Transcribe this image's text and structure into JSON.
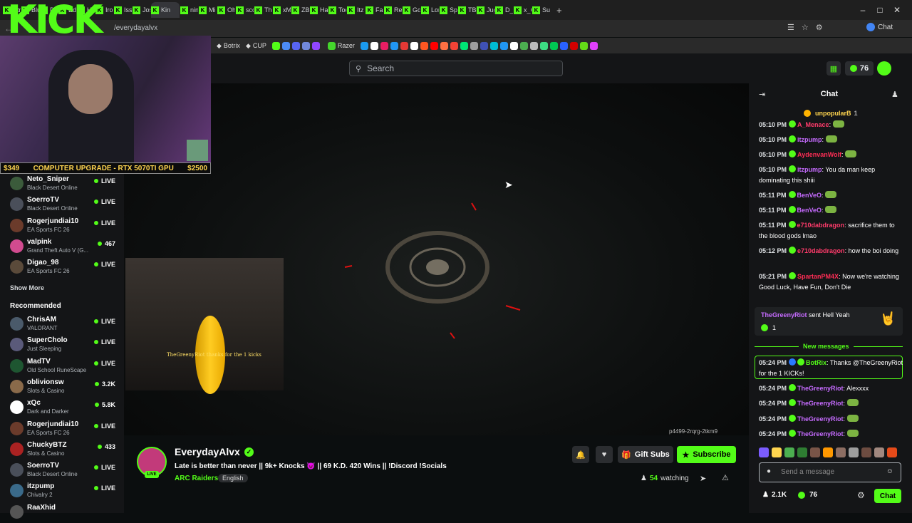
{
  "browser": {
    "tabs": [
      "Str",
      "Blu",
      "De",
      "Edi",
      "Ha",
      "Iro",
      "Iss",
      "Jos",
      "Kin",
      "nin",
      "Mi",
      "Oh",
      "sco",
      "The",
      "xM",
      "ZB",
      "Ha",
      "Toc",
      "Itz",
      "Fal",
      "Re",
      "Go",
      "Lor",
      "Spi",
      "TB",
      "Jug",
      "D_",
      "x_C",
      "Sul"
    ],
    "url": "/everydayalvx",
    "chat_button": "Chat",
    "bookmarks": [
      "Botrix",
      "CUP",
      "Razer"
    ]
  },
  "header": {
    "search_placeholder": "Search",
    "kicks_count": "76"
  },
  "webcam": {
    "logo": "KICK",
    "ticker_left": "$349",
    "ticker_center": "COMPUTER UPGRADE - RTX 5070TI GPU",
    "ticker_right": "$2500"
  },
  "sidebar": {
    "following": [
      {
        "name": "Neto_Sniper",
        "game": "Black Desert Online",
        "status": "LIVE"
      },
      {
        "name": "SoerroTV",
        "game": "Black Desert Online",
        "status": "LIVE"
      },
      {
        "name": "Rogerjundiai10",
        "game": "EA Sports FC 26",
        "status": "LIVE"
      },
      {
        "name": "valpink",
        "game": "Grand Theft Auto V (G...",
        "status": "467"
      },
      {
        "name": "Digao_98",
        "game": "EA Sports FC 26",
        "status": "LIVE"
      }
    ],
    "show_more": "Show More",
    "recommended_label": "Recommended",
    "recommended": [
      {
        "name": "ChrisAM",
        "game": "VALORANT",
        "status": "LIVE"
      },
      {
        "name": "SuperCholo",
        "game": "Just Sleeping",
        "status": "LIVE"
      },
      {
        "name": "MadTV",
        "game": "Old School RuneScape",
        "status": "LIVE"
      },
      {
        "name": "oblivionsw",
        "game": "Slots & Casino",
        "status": "3.2K"
      },
      {
        "name": "xQc",
        "game": "Dark and Darker",
        "status": "5.8K"
      },
      {
        "name": "Rogerjundiai10",
        "game": "EA Sports FC 26",
        "status": "LIVE"
      },
      {
        "name": "ChuckyBTZ",
        "game": "Slots & Casino",
        "status": "433"
      },
      {
        "name": "SoerroTV",
        "game": "Black Desert Online",
        "status": "LIVE"
      },
      {
        "name": "itzpump",
        "game": "Chivalry 2",
        "status": "LIVE"
      },
      {
        "name": "RaaXhid",
        "game": "",
        "status": ""
      }
    ]
  },
  "video": {
    "gift_overlay": "TheGreenyRiot thanks for the 1 kicks",
    "code": "p4499-2rqrg-2tkm9"
  },
  "stream": {
    "streamer": "EverydayAlvx",
    "title": "Late is better than never || 9k+ Knocks 😈 || 69 K.D. 420 Wins || !Discord !Socials",
    "category": "ARC Raiders",
    "language": "English",
    "gift_subs": "Gift Subs",
    "subscribe": "Subscribe",
    "watching_count": "54",
    "watching_label": "watching",
    "live_badge": "LIVE"
  },
  "chat": {
    "title": "Chat",
    "pinned_user": "unpopularB",
    "pinned_count": "1",
    "messages": [
      {
        "time": "05:10 PM",
        "user": "A_Menace",
        "text": "",
        "color": "#ff3b6b"
      },
      {
        "time": "05:10 PM",
        "user": "itzpump",
        "text": "",
        "color": "#c66bff"
      },
      {
        "time": "05:10 PM",
        "user": "AydenvanWolf",
        "text": "",
        "color": "#ff2d55"
      },
      {
        "time": "05:10 PM",
        "user": "itzpump",
        "text": "You da man keep dominating this shiii",
        "color": "#c66bff"
      },
      {
        "time": "05:11 PM",
        "user": "BenVeO",
        "text": "",
        "color": "#c66bff"
      },
      {
        "time": "05:11 PM",
        "user": "BenVeO",
        "text": "",
        "color": "#c66bff"
      },
      {
        "time": "05:11 PM",
        "user": "e710dabdragon",
        "text": "sacrifice them to the blood gods lmao",
        "color": "#ff3b6b"
      },
      {
        "time": "05:12 PM",
        "user": "e710dabdragon",
        "text": "how the boi doing",
        "color": "#ff3b6b"
      },
      {
        "time": "05:21 PM",
        "user": "SpartanPM4X",
        "text": "Now we're watching Good Luck, Have Fun, Don't Die",
        "color": "#ff2d55"
      }
    ],
    "gift_user": "TheGreenyRiot",
    "gift_text": "sent Hell Yeah",
    "gift_amount": "1",
    "new_messages": "New messages",
    "highlight": {
      "time": "05:24 PM",
      "user": "BotRix",
      "text": "Thanks @TheGreenyRiot for the 1 KICKs!"
    },
    "recent": [
      {
        "time": "05:24 PM",
        "user": "TheGreenyRiot",
        "text": "Alexxxx"
      },
      {
        "time": "05:24 PM",
        "user": "TheGreenyRiot",
        "text": ""
      },
      {
        "time": "05:24 PM",
        "user": "TheGreenyRiot",
        "text": ""
      },
      {
        "time": "05:24 PM",
        "user": "TheGreenyRiot",
        "text": ""
      }
    ],
    "input_placeholder": "Send a message",
    "viewers": "2.1K",
    "kicks": "76",
    "send_label": "Chat"
  }
}
